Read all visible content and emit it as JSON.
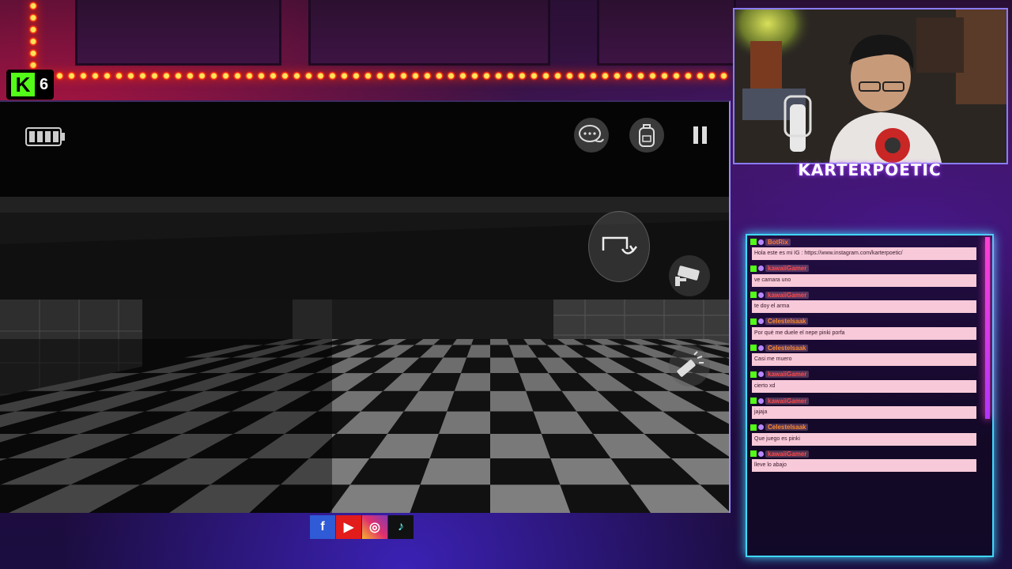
{
  "overlay": {
    "kick_viewers": "6",
    "streamer_name": "KARTERPOETIC",
    "colors": {
      "kick_green": "#53fc18",
      "chat_border": "#3fd7ff",
      "chat_accent": "#ff3fd2",
      "chat_bubble": "#f7c9d9"
    }
  },
  "game_ui": {
    "icons": [
      "battery-icon",
      "chat-bubble-icon",
      "backpack-icon",
      "pause-icon",
      "interact-icon",
      "camera-icon",
      "flashlight-icon"
    ]
  },
  "chat": {
    "messages": [
      {
        "user": "BotRix",
        "text": "Hola este es mi IG : https://www.instagram.com/karterpoetic/"
      },
      {
        "user": "kawaiiGamer",
        "text": "ve camara uno"
      },
      {
        "user": "kawaiiGamer",
        "text": "te doy el arma"
      },
      {
        "user": "Celestelsaak",
        "text": "Por qué me duele el nepe pinki porfa"
      },
      {
        "user": "Celestelsaak",
        "text": "Casi me muero"
      },
      {
        "user": "kawaiiGamer",
        "text": "cierto xd"
      },
      {
        "user": "kawaiiGamer",
        "text": "jajaja"
      },
      {
        "user": "Celestelsaak",
        "text": "Que juego es pinki"
      },
      {
        "user": "kawaiiGamer",
        "text": "lleve lo abajo"
      }
    ]
  },
  "socials": {
    "facebook": "f",
    "youtube": "▶",
    "instagram": "◎",
    "tiktok": "♪"
  }
}
